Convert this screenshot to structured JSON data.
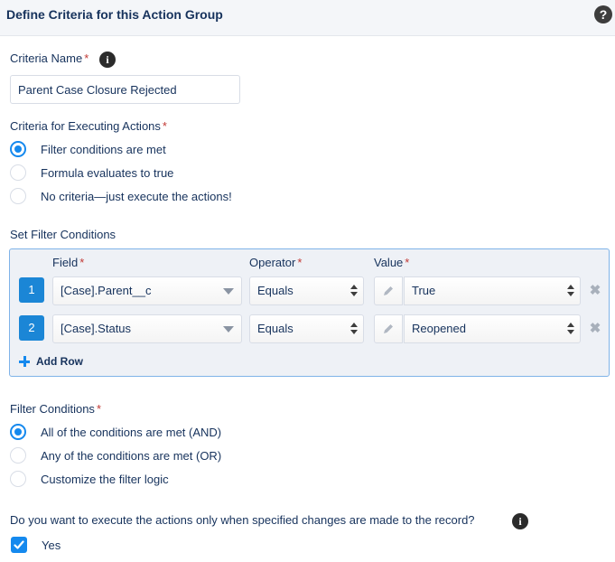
{
  "header": {
    "title": "Define Criteria for this Action Group",
    "help_icon": "?"
  },
  "criteria_name": {
    "label": "Criteria Name",
    "required": "*",
    "info_icon": "i",
    "value": "Parent Case Closure Rejected"
  },
  "criteria_exec": {
    "label": "Criteria for Executing Actions",
    "required": "*",
    "options": [
      {
        "label": "Filter conditions are met",
        "checked": true
      },
      {
        "label": "Formula evaluates to true",
        "checked": false
      },
      {
        "label": "No criteria—just execute the actions!",
        "checked": false
      }
    ]
  },
  "set_filter": {
    "title": "Set Filter Conditions",
    "col_field": "Field",
    "col_operator": "Operator",
    "col_value": "Value",
    "required": "*",
    "rows": [
      {
        "num": "1",
        "field": "[Case].Parent__c",
        "operator": "Equals",
        "value": "True"
      },
      {
        "num": "2",
        "field": "[Case].Status",
        "operator": "Equals",
        "value": "Reopened"
      }
    ],
    "delete_icon": "✖",
    "add_row": "Add Row"
  },
  "filter_conditions": {
    "label": "Filter Conditions",
    "required": "*",
    "options": [
      {
        "label": "All of the conditions are met (AND)",
        "checked": true
      },
      {
        "label": "Any of the conditions are met (OR)",
        "checked": false
      },
      {
        "label": "Customize the filter logic",
        "checked": false
      }
    ]
  },
  "changes_question": {
    "label": "Do you want to execute the actions only when specified changes are made to the record?",
    "info_icon": "i"
  },
  "yes_checkbox": {
    "label": "Yes",
    "checked": true
  },
  "colors": {
    "accent": "#1589ee",
    "row_number": "#1b86d6",
    "required": "#c23934"
  }
}
